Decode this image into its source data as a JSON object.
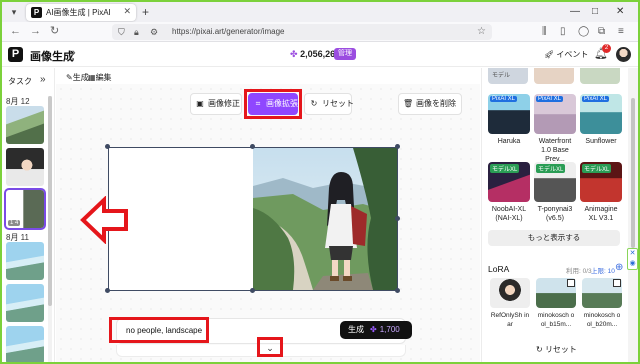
{
  "browser": {
    "tab_title": "AI画像生成 | PixAI",
    "tab_favicon": "P",
    "new_tab": "+",
    "url": "https://pixai.art/generator/image",
    "window_controls": [
      "—",
      "□",
      "✕"
    ]
  },
  "header": {
    "logo": "P",
    "title": "画像生成",
    "chevron": "›",
    "credits": "2,056,261",
    "credits_badge": "管理",
    "event_label": "イベント",
    "notification_count": "2"
  },
  "sidebar": {
    "task_label": "タスク",
    "collapse_icon": "»",
    "dates": [
      "8月 12",
      "8月 11"
    ],
    "selected_meta": "1   4"
  },
  "subtabs": [
    "生成",
    "編集"
  ],
  "toolbar": {
    "buttons": [
      {
        "label": "画像修正",
        "icon": "brush-icon"
      },
      {
        "label": "画像拡張",
        "icon": "crop-expand-icon",
        "active": true
      },
      {
        "label": "リセット",
        "icon": "reset-icon"
      },
      {
        "label": "画像を削除",
        "icon": "trash-icon"
      }
    ]
  },
  "prompt": {
    "text": "no people, landscape",
    "generate_label": "生成",
    "generate_cost": "1,700"
  },
  "right_panel": {
    "top_text": "モデル",
    "models": [
      {
        "name": "Haruka",
        "tag": "PixAI XL",
        "tag_color": "#1f6fe0"
      },
      {
        "name": "Waterfront 1.0 Base Prev...",
        "tag": "PixAI XL",
        "tag_color": "#1f6fe0"
      },
      {
        "name": "Sunflower",
        "tag": "PixAI XL",
        "tag_color": "#1f6fe0"
      },
      {
        "name": "NoobAI-XL (NAI-XL)",
        "tag": "モデルXL",
        "tag_color": "#2a9d55"
      },
      {
        "name": "T-ponynai3 (v6.5)",
        "tag": "モデルXL",
        "tag_color": "#2a9d55"
      },
      {
        "name": "Animagine XL V3.1",
        "tag": "モデルXL",
        "tag_color": "#2a9d55"
      }
    ],
    "more_label": "もっと表示する",
    "lora": {
      "title": "LoRA",
      "count": "利用: 0/3",
      "limit": "上限: 10",
      "plus": "⊕",
      "items": [
        {
          "name": "RefOnlySh inar"
        },
        {
          "name": "minokosch ool_b15m..."
        },
        {
          "name": "minokosch ool_b20m..."
        }
      ]
    },
    "reset_label": "リセット"
  },
  "colors": {
    "accent": "#8f47ff",
    "annotation_red": "#e5161b",
    "frame_green": "#7cd13b"
  }
}
